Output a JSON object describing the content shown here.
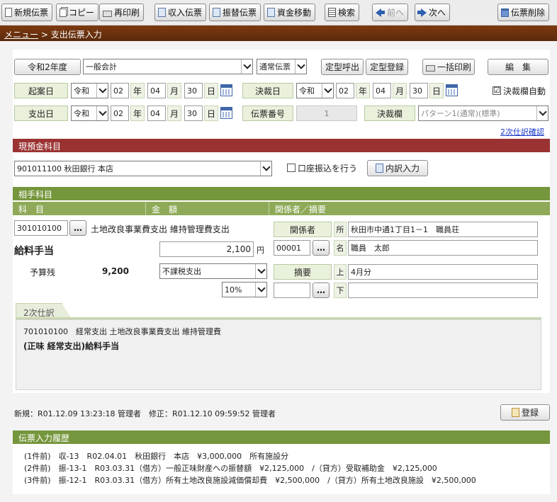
{
  "toolbar": {
    "new": "新規伝票",
    "copy": "コピー",
    "reprint": "再印刷",
    "income": "収入伝票",
    "transfer": "振替伝票",
    "fund_move": "資金移動",
    "search": "検索",
    "prev": "前へ",
    "next": "次へ",
    "delete": "伝票削除"
  },
  "breadcrumb": {
    "menu": "メニュー",
    "sep": ">",
    "current": "支出伝票入力"
  },
  "header": {
    "fiscal_year": "令和2年度",
    "accounting": "一般会計",
    "slip_type": "通常伝票",
    "template_call": "定型呼出",
    "template_save": "定型登録",
    "batch_print": "一括印刷",
    "edit": "編　集",
    "auto_approval_label": "決裁欄自動",
    "auto_approval_checked": "☑"
  },
  "dates": {
    "draft_label": "起案日",
    "approval_label": "決裁日",
    "payment_label": "支出日",
    "era": "令和",
    "year": "02",
    "month": "04",
    "day": "30",
    "unit_year": "年",
    "unit_month": "月",
    "unit_day": "日"
  },
  "slip": {
    "number_label": "伝票番号",
    "number": "1",
    "approval_box_label": "決裁欄",
    "approval_pattern": "パターン1(通常)(標準)",
    "secondary_link": "2次仕訳確認"
  },
  "cash_account": {
    "section_title": "現預金科目",
    "account": "901011100 秋田銀行 本店",
    "transfer_label": "口座振込を行う",
    "breakdown_button": "内訳入力"
  },
  "counter": {
    "section_title": "相手科目",
    "col_subject": "科　目",
    "col_amount": "金　額",
    "col_party": "関係者／摘要",
    "subject_code": "301010100",
    "subject_desc": "土地改良事業費支出 維持管理費支出",
    "subject_name": "給料手当",
    "budget_label": "予算残",
    "budget_value": "9,200",
    "amount": "2,100",
    "yen": "円",
    "tax_type": "不課税支出",
    "tax_rate": "10%",
    "party_label": "関係者",
    "address_prefix": "所",
    "address": "秋田市中通1丁目1－1　職員荘",
    "party_code": "00001",
    "name_prefix": "名",
    "party_name": "職員　太郎",
    "memo_label": "摘要",
    "upper_prefix": "上",
    "memo_upper": "4月分",
    "lower_prefix": "下",
    "memo_lower": "",
    "memo_code": "",
    "ellipsis": "…"
  },
  "secondary": {
    "tab": "2次仕訳",
    "line1": "701010100　経常支出 土地改良事業費支出 維持管理費",
    "line2": "(正味 経常支出)給料手当"
  },
  "footer": {
    "created": "新規：R01.12.09 13:23:18 管理者",
    "modified": "修正：R01.12.10 09:59:52 管理者",
    "register": "登録"
  },
  "history": {
    "title": "伝票入力履歴",
    "rows": [
      "(1件前)　収-13　R02.04.01　秋田銀行　本店　¥3,000,000　所有施設分",
      "(2件前)　振-13-1　R03.03.31（借方）一般正味財産への振替額　¥2,125,000　/（貸方）受取補助金　¥2,125,000",
      "(3件前)　振-12-1　R03.03.31（借方）所有土地改良施設減価償却費　¥2,500,000　/（貸方）所有土地改良施設　¥2,500,000"
    ]
  },
  "colors": {
    "breadcrumb_bg": "#6b320e",
    "cash_section": "#9b3232",
    "counter_section": "#75963c",
    "label_bg": "#e9f1dc",
    "link": "#1a37c8"
  }
}
